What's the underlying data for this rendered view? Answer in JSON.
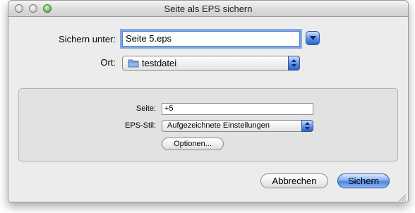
{
  "window": {
    "title": "Seite als EPS sichern"
  },
  "save_as": {
    "label": "Sichern unter:",
    "value": "Seite 5.eps"
  },
  "location": {
    "label": "Ort:",
    "value": "testdatei",
    "icon": "folder-icon"
  },
  "options": {
    "page_label": "Seite:",
    "page_value": "+5",
    "eps_style_label": "EPS-Stil:",
    "eps_style_value": "Aufgezeichnete Einstellungen",
    "options_button": "Optionen..."
  },
  "buttons": {
    "cancel": "Abbrechen",
    "save": "Sichern"
  },
  "colors": {
    "accent": "#4f86e0",
    "focus_ring": "#7fa8e8"
  }
}
